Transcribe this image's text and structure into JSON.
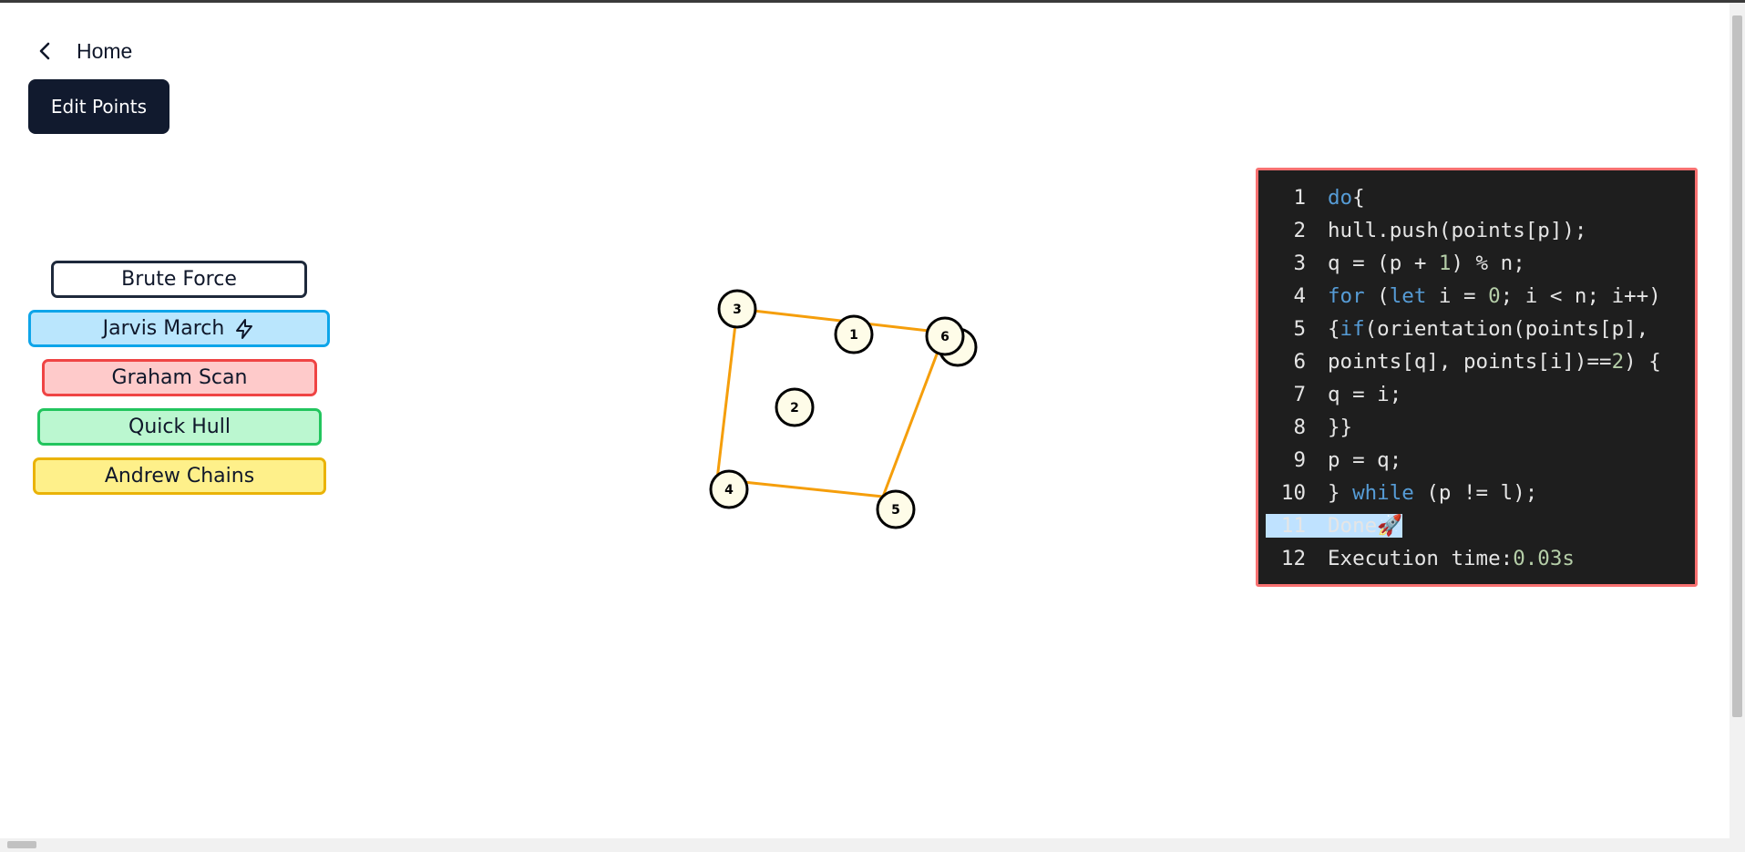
{
  "nav": {
    "back_label": "Home"
  },
  "toolbar": {
    "edit_label": "Edit Points"
  },
  "algorithms": {
    "brute": {
      "label": "Brute Force",
      "color": "#1e293b"
    },
    "jarvis": {
      "label": "Jarvis March",
      "color": "#0ea5e9",
      "active": true,
      "icon": "bolt-icon"
    },
    "graham": {
      "label": "Graham Scan",
      "color": "#ef4444"
    },
    "quick": {
      "label": "Quick Hull",
      "color": "#22c55e"
    },
    "andrew": {
      "label": "Andrew Chains",
      "color": "#eab308"
    }
  },
  "points": [
    "1",
    "2",
    "3",
    "4",
    "5",
    "6"
  ],
  "hull": {
    "order": [
      "3",
      "6",
      "5",
      "4"
    ],
    "color": "#f59e0b"
  },
  "code": {
    "lines": [
      "1",
      "2",
      "3",
      "4",
      "5",
      "6",
      "7",
      "8",
      "9",
      "10",
      "11",
      "12"
    ],
    "highlighted_line": "11",
    "text": [
      "do{",
      "hull.push(points[p]);",
      "q = (p + 1) % n;",
      "for (let i = 0; i < n; i++)",
      "{if(orientation(points[p],",
      "points[q], points[i])==2) {",
      "q = i;",
      "}}",
      "p = q;",
      "} while (p != l);",
      "Done🚀",
      "Execution time:0.03s"
    ]
  },
  "colors": {
    "panel_bg": "#1e1e1e",
    "panel_border": "#f87171",
    "keyword": "#569cd6",
    "number": "#b5cea8"
  }
}
